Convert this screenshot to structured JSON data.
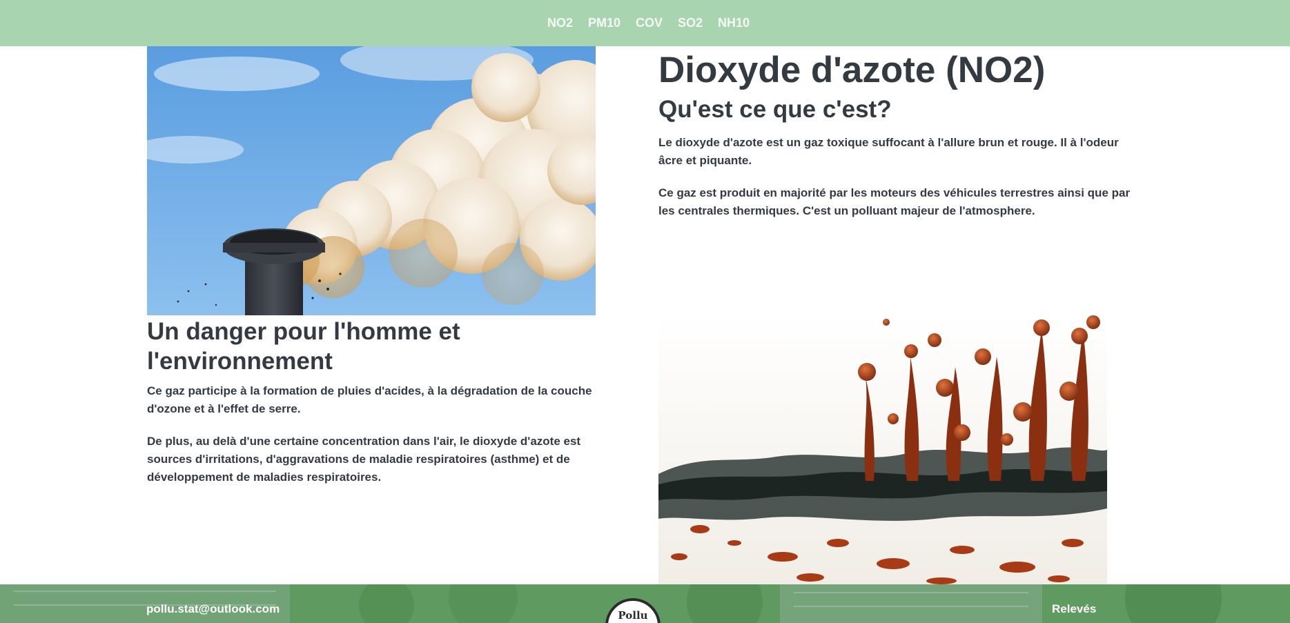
{
  "nav": {
    "items": [
      {
        "label": "NO2"
      },
      {
        "label": "PM10"
      },
      {
        "label": "COV"
      },
      {
        "label": "SO2"
      },
      {
        "label": "NH10"
      }
    ]
  },
  "article": {
    "title": "Dioxyde d'azote (NO2)",
    "what_heading": "Qu'est ce que c'est?",
    "what_p1": "Le dioxyde d'azote est un gaz toxique suffocant à l'allure brun et rouge. Il à l'odeur âcre et piquante.",
    "what_p2": "Ce gaz est produit en majorité par les moteurs des véhicules terrestres ainsi que par les centrales thermiques. C'est un polluant majeur de l'atmosphere.",
    "danger_heading": "Un danger pour l'homme et l'environnement",
    "danger_p1": "Ce gaz participe à la formation de pluies d'acides, à la dégradation de la couche d'ozone et à l'effet de serre.",
    "danger_p2": "De plus, au delà d'une certaine concentration dans l'air, le dioxyde d'azote est sources d'irritations, d'aggravations de maladie respiratoires (asthme) et de développement de maladies respiratoires."
  },
  "footer": {
    "email": "pollu.stat@outlook.com",
    "logo_text": "Pollu",
    "releves": "Relevés"
  },
  "colors": {
    "nav_bg": "#a8d5b0",
    "footer_bg": "#5d9e5e",
    "text": "#333a42"
  }
}
